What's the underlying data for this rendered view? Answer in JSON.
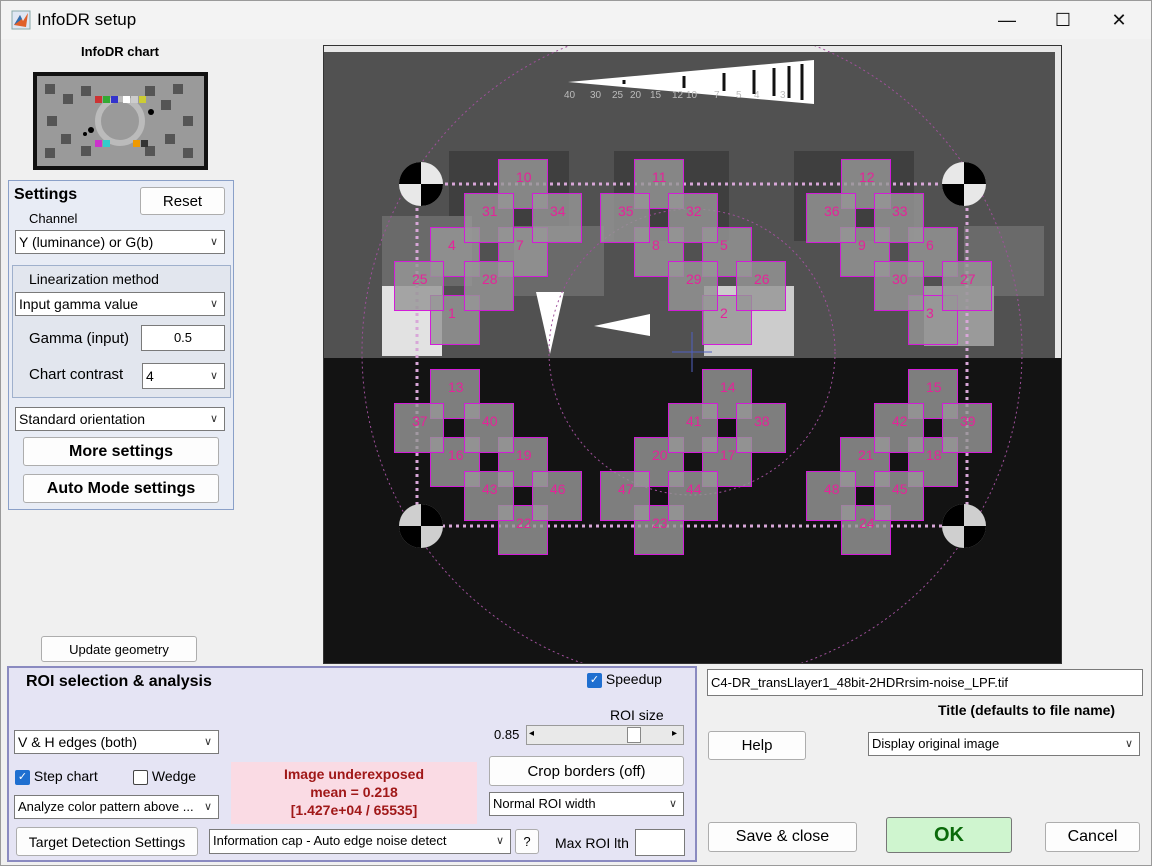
{
  "window": {
    "title": "InfoDR setup",
    "minimize": "—",
    "maximize": "☐",
    "close": "✕"
  },
  "chart_thumb": {
    "title": "InfoDR chart"
  },
  "settings": {
    "title": "Settings",
    "reset": "Reset",
    "channel_label": "Channel",
    "channel_value": "Y (luminance) or G(b)",
    "lin_label": "Linearization method",
    "lin_value": "Input gamma value",
    "gamma_label": "Gamma (input)",
    "gamma_value": "0.5",
    "contrast_label": "Chart contrast",
    "contrast_value": "4",
    "orientation_value": "Standard orientation",
    "more_settings": "More settings",
    "auto_mode": "Auto Mode settings"
  },
  "update_geometry": "Update geometry",
  "image": {
    "scale_labels": [
      "40",
      "30",
      "25",
      "20",
      "15",
      "12",
      "10",
      "7",
      "5",
      "4",
      "3"
    ],
    "roi_numbers": [
      "1",
      "2",
      "3",
      "4",
      "5",
      "6",
      "7",
      "8",
      "9",
      "10",
      "11",
      "12",
      "13",
      "14",
      "15",
      "16",
      "17",
      "18",
      "19",
      "20",
      "21",
      "22",
      "23",
      "24",
      "25",
      "26",
      "27",
      "28",
      "29",
      "30",
      "31",
      "32",
      "33",
      "34",
      "35",
      "36",
      "37",
      "38",
      "39",
      "40",
      "41",
      "42",
      "43",
      "44",
      "45",
      "46",
      "47",
      "48"
    ]
  },
  "roi": {
    "title": "ROI selection & analysis",
    "speedup": "Speedup",
    "roi_size_label": "ROI size",
    "roi_size_value": "0.85",
    "edges_value": "V & H edges (both)",
    "step_chart": "Step chart",
    "wedge": "Wedge",
    "analyze_value": "Analyze color pattern above ...",
    "target_detection": "Target Detection Settings",
    "warn_line1": "Image underexposed",
    "warn_line2": "mean = 0.218",
    "warn_line3": "[1.427e+04 / 65535]",
    "crop_borders": "Crop borders  (off)",
    "roi_width_value": "Normal ROI width",
    "info_cap_value": "Information cap -  Auto edge noise detect",
    "help_q": "?",
    "max_roi_label": "Max ROI lth",
    "max_roi_value": ""
  },
  "right": {
    "filename": "C4-DR_transLlayer1_48bit-2HDRrsim-noise_LPF.tif",
    "title_label": "Title (defaults to file name)",
    "help": "Help",
    "display_value": "Display original image",
    "save_close": "Save & close",
    "ok": "OK",
    "cancel": "Cancel"
  },
  "colors": {
    "accent": "#1f6fd0",
    "roi_border": "#d21cd8",
    "roi_number": "#e5239a",
    "warn_bg": "#fadbe4",
    "warn_text": "#a01818",
    "ok_bg": "#cff5cf",
    "ok_text": "#0a6a0a"
  }
}
